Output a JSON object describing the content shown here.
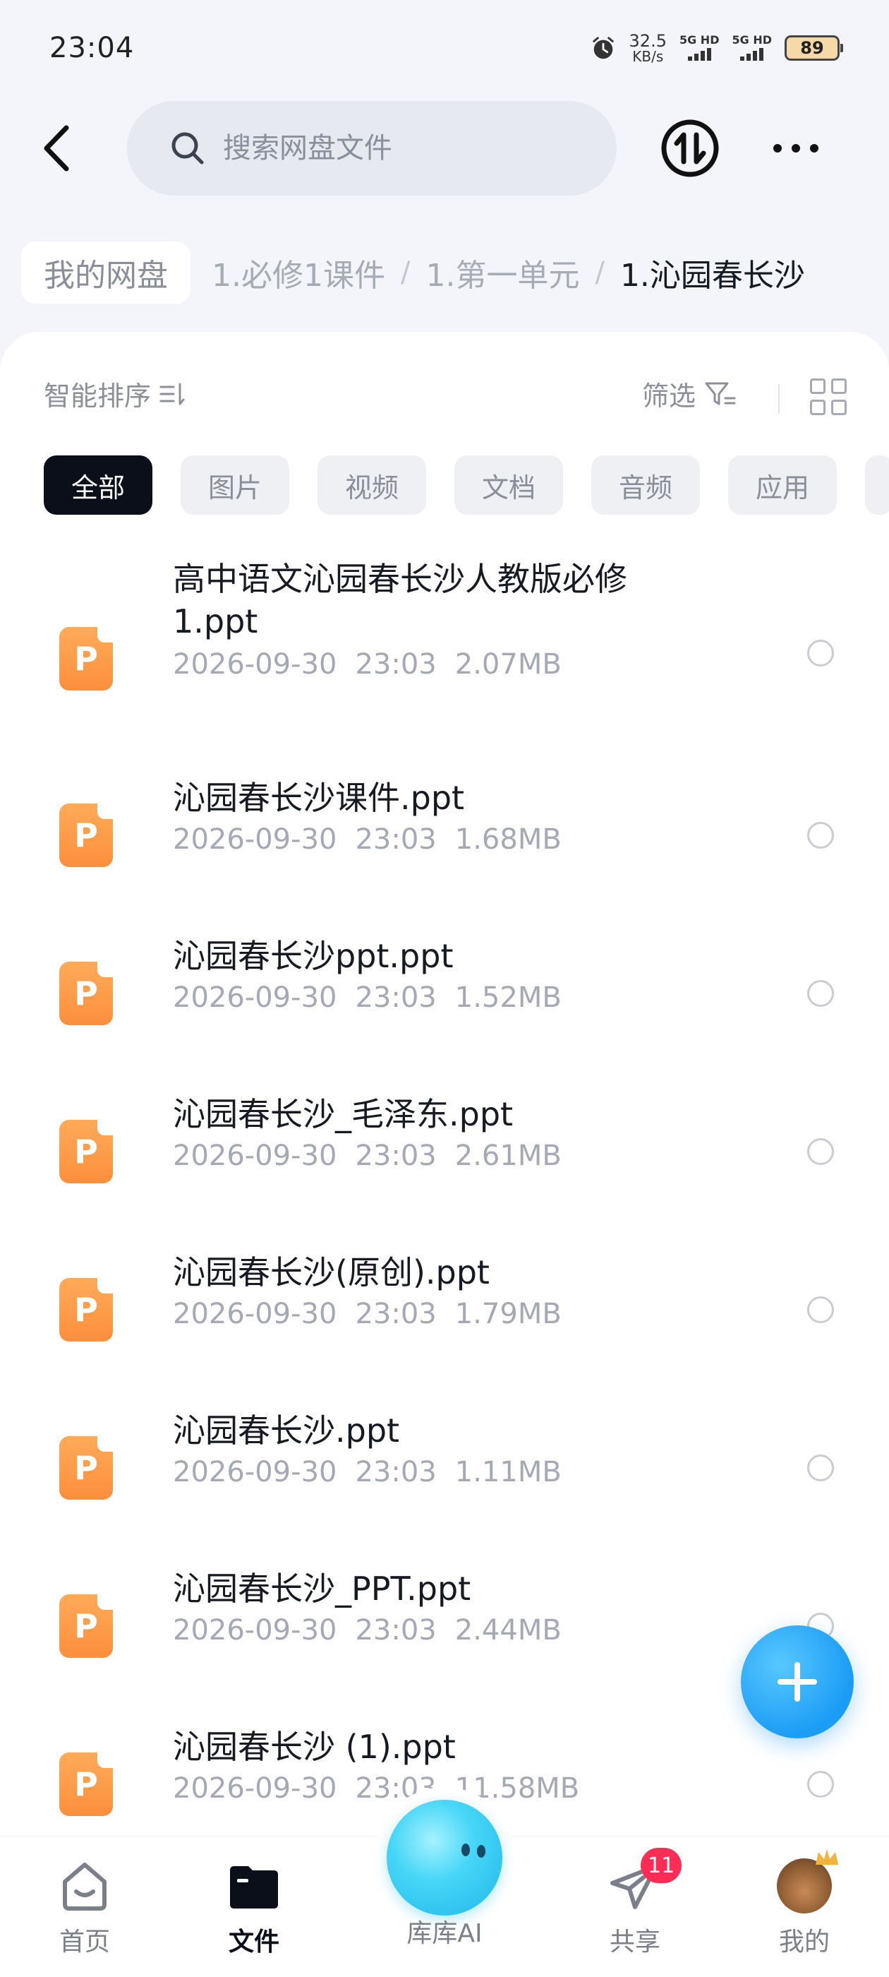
{
  "status": {
    "time": "23:04",
    "speed_value": "32.5",
    "speed_unit": "KB/s",
    "sim1_label": "5G HD",
    "sim2_label": "5G HD",
    "battery": "89"
  },
  "search": {
    "placeholder": "搜索网盘文件"
  },
  "breadcrumb": {
    "root": "我的网盘",
    "level1": "1.必修1课件",
    "level2": "1.第一单元",
    "current": "1.沁园春长沙"
  },
  "toolbar": {
    "sort_label": "智能排序",
    "filter_label": "筛选"
  },
  "filter_chips": [
    "全部",
    "图片",
    "视频",
    "文档",
    "音频",
    "应用"
  ],
  "files": [
    {
      "name": "高中语文沁园春长沙人教版必修1.ppt",
      "date": "2026-09-30",
      "time": "23:03",
      "size": "2.07MB"
    },
    {
      "name": "沁园春长沙课件.ppt",
      "date": "2026-09-30",
      "time": "23:03",
      "size": "1.68MB"
    },
    {
      "name": "沁园春长沙ppt.ppt",
      "date": "2026-09-30",
      "time": "23:03",
      "size": "1.52MB"
    },
    {
      "name": "沁园春长沙_毛泽东.ppt",
      "date": "2026-09-30",
      "time": "23:03",
      "size": "2.61MB"
    },
    {
      "name": "沁园春长沙(原创).ppt",
      "date": "2026-09-30",
      "time": "23:03",
      "size": "1.79MB"
    },
    {
      "name": "沁园春长沙.ppt",
      "date": "2026-09-30",
      "time": "23:03",
      "size": "1.11MB"
    },
    {
      "name": "沁园春长沙_PPT.ppt",
      "date": "2026-09-30",
      "time": "23:03",
      "size": "2.44MB"
    },
    {
      "name": "沁园春长沙 (1).ppt",
      "date": "2026-09-30",
      "time": "23:03",
      "size": "11.58MB"
    }
  ],
  "file_icon_letter": "P",
  "nav": {
    "home": "首页",
    "files": "文件",
    "ai": "库库AI",
    "share": "共享",
    "share_badge": "11",
    "mine": "我的"
  },
  "colors": {
    "accent": "#1b9cf5",
    "file_icon": "#fb8f3c",
    "badge": "#ff2d55",
    "active_chip": "#0b0f1a"
  }
}
